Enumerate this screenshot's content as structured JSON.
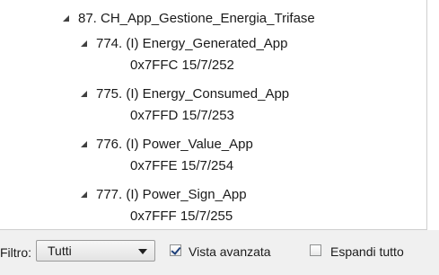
{
  "tree": {
    "group": {
      "label": "87. CH_App_Gestione_Energia_Trifase"
    },
    "items": [
      {
        "label": "774. (I) Energy_Generated_App",
        "address": "0x7FFC 15/7/252"
      },
      {
        "label": "775. (I) Energy_Consumed_App",
        "address": "0x7FFD 15/7/253"
      },
      {
        "label": "776. (I) Power_Value_App",
        "address": "0x7FFE 15/7/254"
      },
      {
        "label": "777. (I) Power_Sign_App",
        "address": "0x7FFF 15/7/255"
      }
    ]
  },
  "footer": {
    "filter_label": "Filtro:",
    "filter_value": "Tutti",
    "advanced_view_label": "Vista avanzata",
    "advanced_view_checked": true,
    "expand_all_label": "Espandi tutto",
    "expand_all_checked": false
  }
}
